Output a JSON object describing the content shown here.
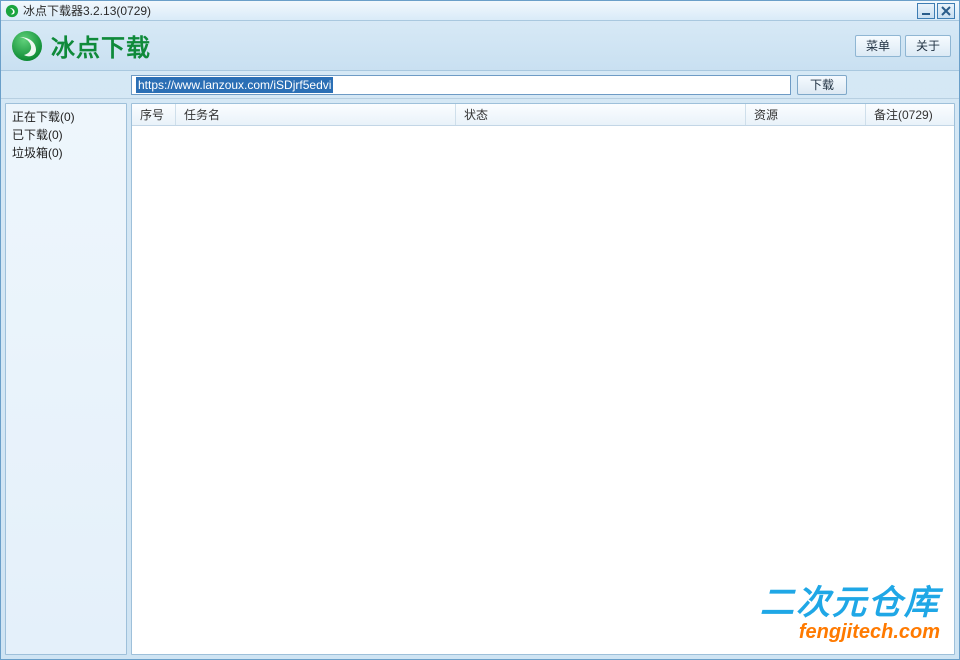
{
  "window": {
    "title": "冰点下载器3.2.13(0729)"
  },
  "header": {
    "app_name": "冰点下载",
    "menu_label": "菜单",
    "about_label": "关于"
  },
  "toolbar": {
    "url_value": "https://www.lanzoux.com/iSDjrf5edvi",
    "download_label": "下载"
  },
  "sidebar": {
    "items": [
      {
        "label": "正在下载(0)"
      },
      {
        "label": "已下载(0)"
      },
      {
        "label": "垃圾箱(0)"
      }
    ]
  },
  "columns": {
    "index": "序号",
    "task_name": "任务名",
    "status": "状态",
    "resource": "资源",
    "note": "备注(0729)"
  },
  "watermark": {
    "line1": "二次元仓库",
    "line2": "fengjitech.com"
  }
}
